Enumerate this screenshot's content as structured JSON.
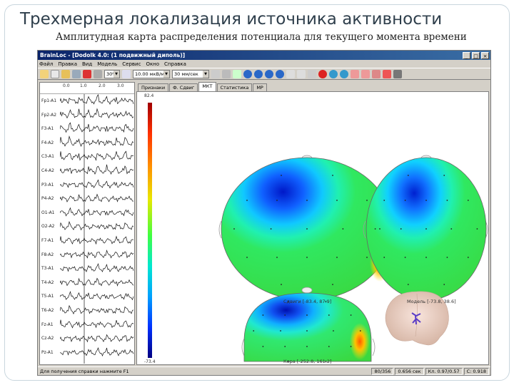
{
  "slide": {
    "title": "Трехмерная локализация источника активности",
    "subtitle": "Амплитудная карта распределения потенциала для текущего момента времени"
  },
  "window": {
    "title": "BrainLoc - [Dodolk 4.0: (1 подвижный диполь)]",
    "menu": [
      "Файл",
      "Правка",
      "Вид",
      "Модель",
      "Сервис",
      "Окно",
      "Справка"
    ]
  },
  "toolbar": {
    "zoom": "30%",
    "amplitude": "10.00 мкВ/мм",
    "speed": "30 мм/сек"
  },
  "eeg": {
    "scale_ticks": [
      "0.0",
      "1.0",
      "2.0",
      "3.0"
    ],
    "channels": [
      "Fp1-A1",
      "Fp2-A2",
      "F3-A1",
      "F4-A2",
      "C3-A1",
      "C4-A2",
      "P3-A1",
      "P4-A2",
      "O1-A1",
      "O2-A2",
      "F7-A1",
      "F8-A2",
      "T3-A1",
      "T4-A2",
      "T5-A1",
      "T6-A2",
      "Fz-A1",
      "Cz-A2",
      "Pz-A1"
    ]
  },
  "tabs": [
    "Признаки",
    "Ф. Сдвиг",
    "МКТ",
    "Статистика",
    "МР"
  ],
  "colorbar": {
    "max": "82.4",
    "min": "-73.4"
  },
  "maps": {
    "map1_caption": "Сдвиги [-83.4, 87.9]",
    "map2_caption": "Модель [-73.8, 38.6]",
    "map3_caption": "Кора [-252.8, 161.2]"
  },
  "status": {
    "left": "Для получения справки нажмите F1",
    "cells": [
      "80/356",
      "0.656 сек",
      "Кл. 0.97/0.57",
      "С: 0.918"
    ]
  }
}
